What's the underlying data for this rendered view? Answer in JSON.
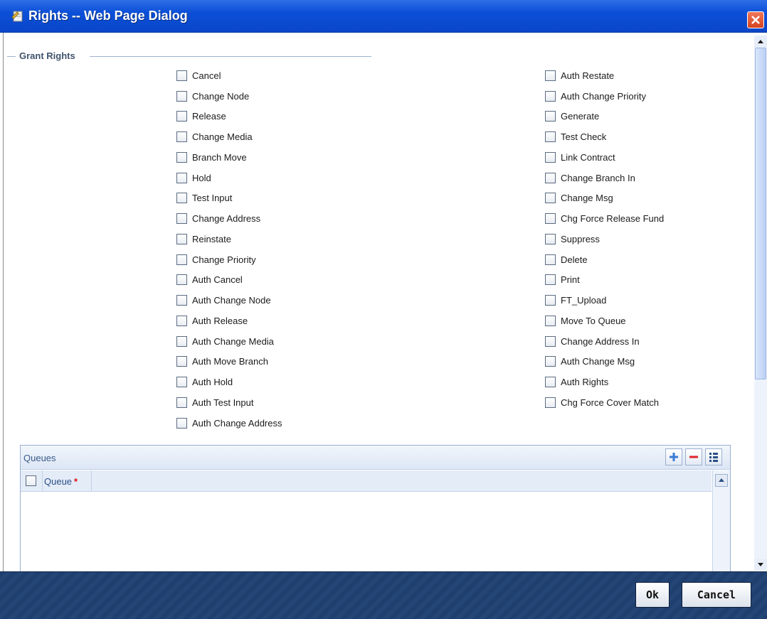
{
  "window": {
    "title": "Rights -- Web Page Dialog"
  },
  "grant_rights": {
    "legend": "Grant Rights",
    "left_column": [
      {
        "label": "Cancel",
        "checked": false
      },
      {
        "label": "Change Node",
        "checked": false
      },
      {
        "label": "Release",
        "checked": false
      },
      {
        "label": "Change Media",
        "checked": false
      },
      {
        "label": "Branch Move",
        "checked": false
      },
      {
        "label": "Hold",
        "checked": false
      },
      {
        "label": "Test Input",
        "checked": false
      },
      {
        "label": "Change Address",
        "checked": false
      },
      {
        "label": "Reinstate",
        "checked": false
      },
      {
        "label": "Change Priority",
        "checked": false
      },
      {
        "label": "Auth Cancel",
        "checked": false
      },
      {
        "label": "Auth Change Node",
        "checked": false
      },
      {
        "label": "Auth Release",
        "checked": false
      },
      {
        "label": "Auth Change Media",
        "checked": false
      },
      {
        "label": "Auth Move Branch",
        "checked": false
      },
      {
        "label": "Auth Hold",
        "checked": false
      },
      {
        "label": "Auth Test Input",
        "checked": false
      },
      {
        "label": "Auth Change Address",
        "checked": false
      }
    ],
    "right_column": [
      {
        "label": "Auth Restate",
        "checked": false
      },
      {
        "label": "Auth Change Priority",
        "checked": false
      },
      {
        "label": "Generate",
        "checked": false
      },
      {
        "label": "Test Check",
        "checked": false
      },
      {
        "label": "Link Contract",
        "checked": false
      },
      {
        "label": "Change Branch In",
        "checked": false
      },
      {
        "label": "Change Msg",
        "checked": false
      },
      {
        "label": "Chg Force Release Fund",
        "checked": false
      },
      {
        "label": "Suppress",
        "checked": false
      },
      {
        "label": "Delete",
        "checked": false
      },
      {
        "label": "Print",
        "checked": false
      },
      {
        "label": "FT_Upload",
        "checked": false
      },
      {
        "label": "Move To Queue",
        "checked": false
      },
      {
        "label": "Change Address In",
        "checked": false
      },
      {
        "label": "Auth Change Msg",
        "checked": false
      },
      {
        "label": "Auth Rights",
        "checked": false
      },
      {
        "label": "Chg Force Cover Match",
        "checked": false
      }
    ]
  },
  "queues": {
    "title": "Queues",
    "column_header": "Queue",
    "required_mark": "*",
    "icons": [
      "plus-icon",
      "minus-icon",
      "list-icon"
    ],
    "rows": []
  },
  "footer": {
    "ok_label": "Ok",
    "cancel_label": "Cancel"
  },
  "colors": {
    "titlebar": "#0b4fd8",
    "footer": "#1f3f6f",
    "legend_text": "#40536b",
    "queue_header_text": "#2a4f86",
    "required": "#e01010"
  }
}
